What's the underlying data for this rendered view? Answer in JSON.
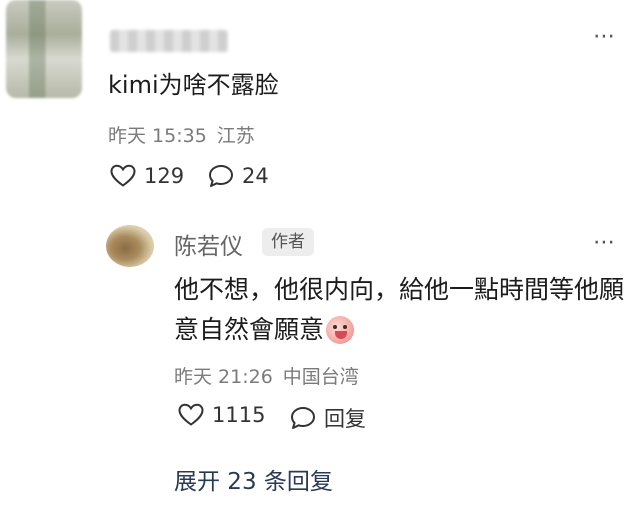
{
  "top_comment": {
    "content": "kimi为啥不露脸",
    "time": "昨天 15:35",
    "location": "江苏",
    "likes": "129",
    "comments": "24"
  },
  "reply": {
    "author": "陈若仪",
    "badge": "作者",
    "content": "他不想，他很内向，給他一點時間等他願意自然會願意",
    "time": "昨天 21:26",
    "location": "中国台湾",
    "likes": "1115",
    "reply_label": "回复"
  },
  "expand_label": "展开 23 条回复",
  "icons": {
    "more": "more-dots-icon",
    "like": "heart-outline-icon",
    "comment": "speech-bubble-icon",
    "emoji": "blushing-face-emoji"
  }
}
